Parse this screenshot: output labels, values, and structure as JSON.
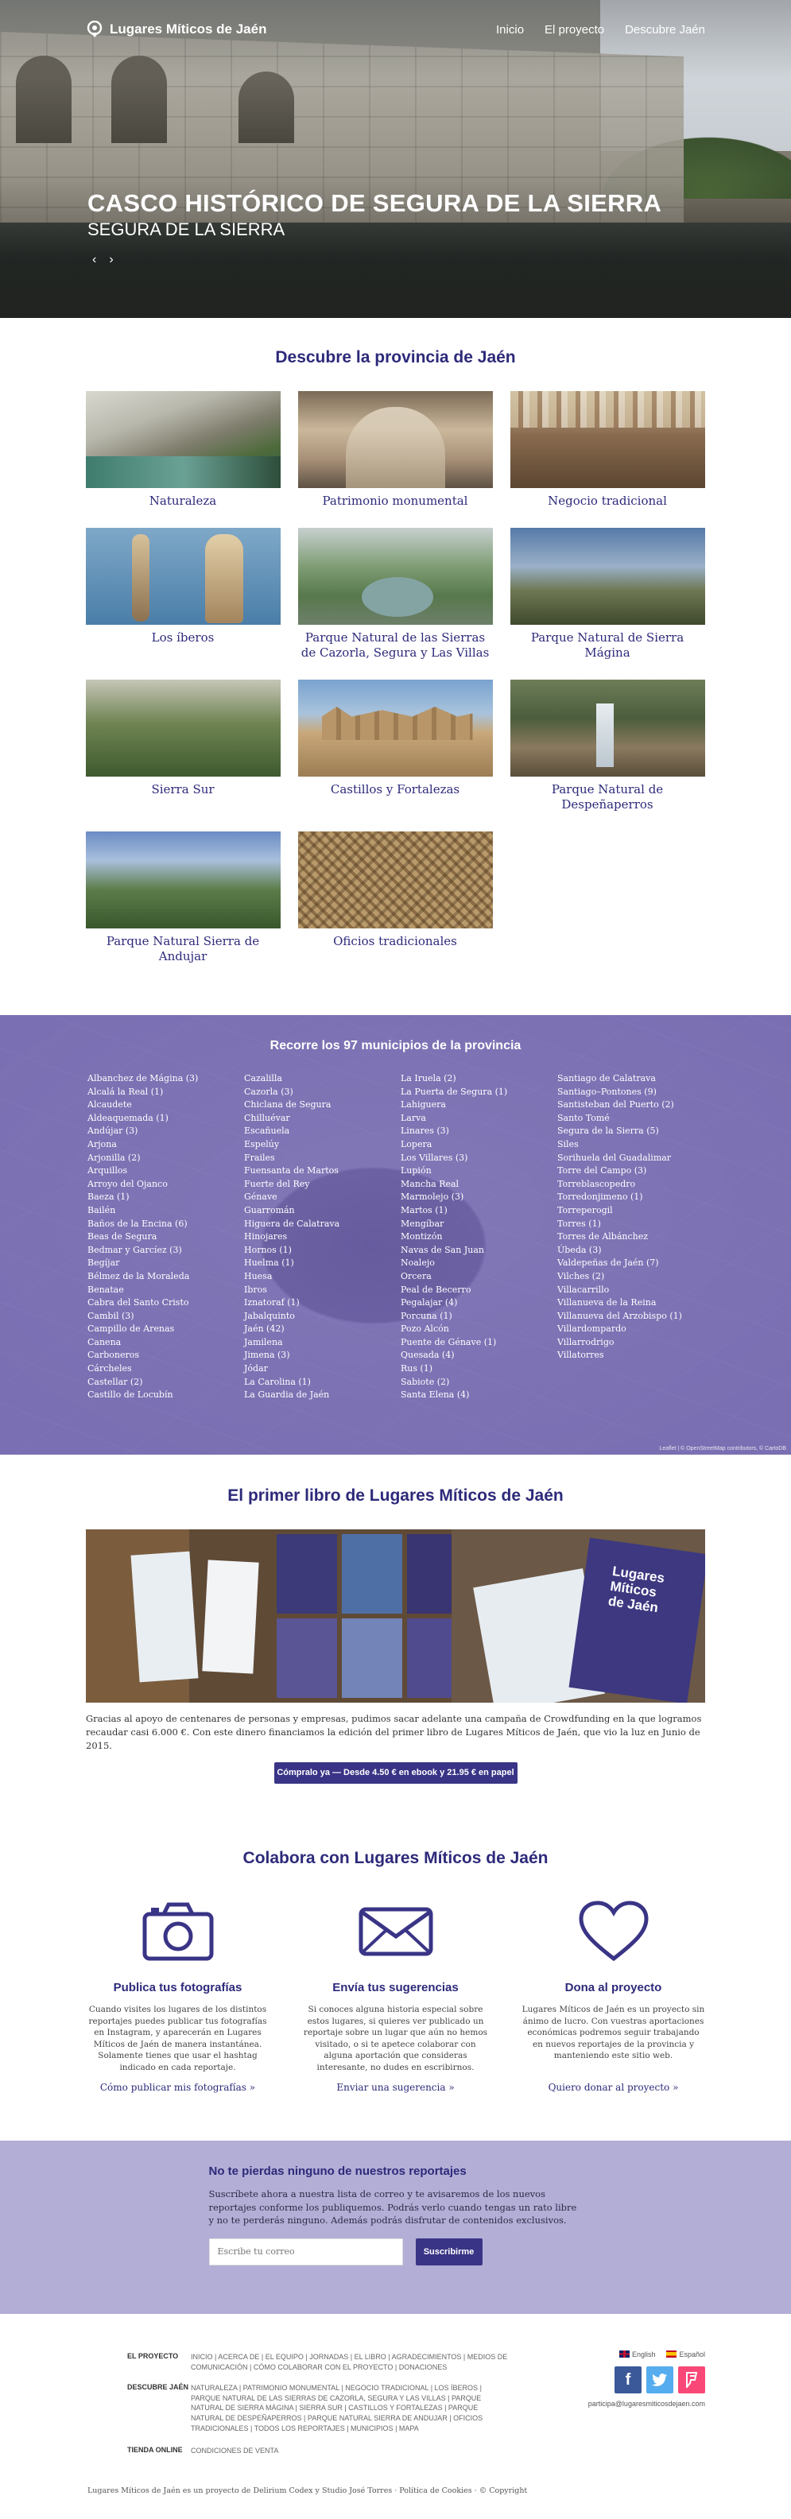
{
  "site": {
    "logo_text": "Lugares Míticos de Jaén",
    "nav": [
      "Inicio",
      "El proyecto",
      "Descubre Jaén"
    ]
  },
  "hero": {
    "title": "CASCO HISTÓRICO DE SEGURA DE LA SIERRA",
    "subtitle": "SEGURA DE LA SIERRA",
    "prev": "‹",
    "next": "›"
  },
  "discover": {
    "title": "Descubre la provincia de Jaén",
    "categories": [
      "Naturaleza",
      "Patrimonio monumental",
      "Negocio tradicional",
      "Los íberos",
      "Parque Natural de las Sierras de Cazorla, Segura y Las Villas",
      "Parque Natural de Sierra Mágina",
      "Sierra Sur",
      "Castillos y Fortalezas",
      "Parque Natural de Despeñaperros",
      "Parque Natural Sierra de Andujar",
      "Oficios tradicionales"
    ]
  },
  "municipios": {
    "title": "Recorre los 97 municipios de la provincia",
    "col1": [
      "Albanchez de Mágina (3)",
      "Alcalá la Real (1)",
      "Alcaudete",
      "Aldeaquemada (1)",
      "Andújar (3)",
      "Arjona",
      "Arjonilla (2)",
      "Arquillos",
      "Arroyo del Ojanco",
      "Baeza (1)",
      "Bailén",
      "Baños de la Encina (6)",
      "Beas de Segura",
      "Bedmar y Garcíez (3)",
      "Begíjar",
      "Bélmez de la Moraleda",
      "Benatae",
      "Cabra del Santo Cristo",
      "Cambil (3)",
      "Campillo de Arenas",
      "Canena",
      "Carboneros",
      "Cárcheles",
      "Castellar (2)",
      "Castillo de Locubín"
    ],
    "col2": [
      "Cazalilla",
      "Cazorla (3)",
      "Chiclana de Segura",
      "Chilluévar",
      "Escañuela",
      "Espelúy",
      "Frailes",
      "Fuensanta de Martos",
      "Fuerte del Rey",
      "Génave",
      "Guarromán",
      "Higuera de Calatrava",
      "Hinojares",
      "Hornos (1)",
      "Huelma (1)",
      "Huesa",
      "Ibros",
      "Iznatoraf (1)",
      "Jabalquinto",
      "Jaén (42)",
      "Jamilena",
      "Jimena (3)",
      "Jódar",
      "La Carolina (1)",
      "La Guardia de Jaén"
    ],
    "col3": [
      "La Iruela (2)",
      "La Puerta de Segura (1)",
      "Lahiguera",
      "Larva",
      "Linares (3)",
      "Lopera",
      "Los Villares (3)",
      "Lupión",
      "Mancha Real",
      "Marmolejo (3)",
      "Martos (1)",
      "Mengíbar",
      "Montizón",
      "Navas de San Juan",
      "Noalejo",
      "Orcera",
      "Peal de Becerro",
      "Pegalajar (4)",
      "Porcuna (1)",
      "Pozo Alcón",
      "Puente de Génave (1)",
      "Quesada (4)",
      "Rus (1)",
      "Sabiote (2)",
      "Santa Elena (4)"
    ],
    "col4": [
      "Santiago de Calatrava",
      "Santiago–Pontones (9)",
      "Santisteban del Puerto (2)",
      "Santo Tomé",
      "Segura de la Sierra (5)",
      "Siles",
      "Sorihuela del Guadalimar",
      "Torre del Campo (3)",
      "Torreblascopedro",
      "Torredonjimeno (1)",
      "Torreperogil",
      "Torres (1)",
      "Torres de Albánchez",
      "Úbeda (3)",
      "Valdepeñas de Jaén (7)",
      "Vilches (2)",
      "Villacarrillo",
      "Villanueva de la Reina",
      "Villanueva del Arzobispo (1)",
      "Villardompardo",
      "Villarrodrigo",
      "Villatorres"
    ],
    "attribution": "Leaflet | © OpenStreetMap contributors, © CartoDB"
  },
  "book": {
    "title": "El primer libro de Lugares Míticos de Jaén",
    "text": "Gracias al apoyo de centenares de personas y empresas, pudimos sacar adelante una campaña de Crowdfunding en la que logramos recaudar casi 6.000 €. Con este dinero financiamos la edición del primer libro de Lugares Míticos de Jaén, que vio la luz en Junio de 2015.",
    "buy_label": "Cómpralo ya — Desde 4.50 € en ebook y 21.95 € en papel",
    "cover_title": "Lugares Míticos de Jaén"
  },
  "collab": {
    "title": "Colabora con Lugares Míticos de Jaén",
    "items": [
      {
        "icon": "camera-icon",
        "title": "Publica tus fotografías",
        "text": "Cuando visites los lugares de los distintos reportajes puedes publicar tus fotografías en Instagram, y aparecerán en Lugares Míticos de Jaén de manera instantánea. Solamente tienes que usar el hashtag indicado en cada reportaje.",
        "link": "Cómo publicar mis fotografías »"
      },
      {
        "icon": "envelope-icon",
        "title": "Envía tus sugerencias",
        "text": "Si conoces alguna historia especial sobre estos lugares, si quieres ver publicado un reportaje sobre un lugar que aún no hemos visitado, o si te apetece colaborar con alguna aportación que consideras interesante, no dudes en escribirnos.",
        "link": "Enviar una sugerencia »"
      },
      {
        "icon": "heart-icon",
        "title": "Dona al proyecto",
        "text": "Lugares Míticos de Jaén es un proyecto sin ánimo de lucro. Con vuestras aportaciones económicas podremos seguir trabajando en nuevos reportajes de la provincia y manteniendo este sitio web.",
        "link": "Quiero donar al proyecto »"
      }
    ]
  },
  "newsletter": {
    "title": "No te pierdas ninguno de nuestros reportajes",
    "text": "Suscríbete ahora a nuestra lista de correo y te avisaremos de los nuevos reportajes conforme los publiquemos. Podrás verlo cuando tengas un rato libre y no te perderás ninguno. Además podrás disfrutar de contenidos exclusivos.",
    "placeholder": "Escribe tu correo",
    "button": "Suscribirme"
  },
  "footer": {
    "proyecto_label": "EL PROYECTO",
    "proyecto_links": "INICIO | ACERCA DE | EL EQUIPO | JORNADAS | EL LIBRO | AGRADECIMIENTOS | MEDIOS DE COMUNICACIÓN | CÓMO COLABORAR CON EL PROYECTO | DONACIONES",
    "descubre_label": "DESCUBRE JAÉN",
    "descubre_links": "NATURALEZA | PATRIMONIO MONUMENTAL | NEGOCIO TRADICIONAL | LOS ÍBEROS | PARQUE NATURAL DE LAS SIERRAS DE CAZORLA, SEGURA Y LAS VILLAS | PARQUE NATURAL DE SIERRA MÁGINA | SIERRA SUR | CASTILLOS Y FORTALEZAS | PARQUE NATURAL DE DESPEÑAPERROS | PARQUE NATURAL SIERRA DE ANDUJAR | OFICIOS TRADICIONALES | TODOS LOS REPORTAJES | MUNICIPIOS | MAPA",
    "tienda_label": "TIENDA ONLINE",
    "tienda_links": "CONDICIONES DE VENTA",
    "lang_en": "English",
    "lang_es": "Español",
    "email": "participa@lugaresmiticosdejaen.com",
    "credits": "Lugares Míticos de Jaén es un proyecto de Delirium Codex y Studio José Torres · Política de Cookies · © Copyright",
    "colors": {
      "facebook": "#3b5998",
      "twitter": "#55acee",
      "foursquare": "#f94877"
    }
  }
}
